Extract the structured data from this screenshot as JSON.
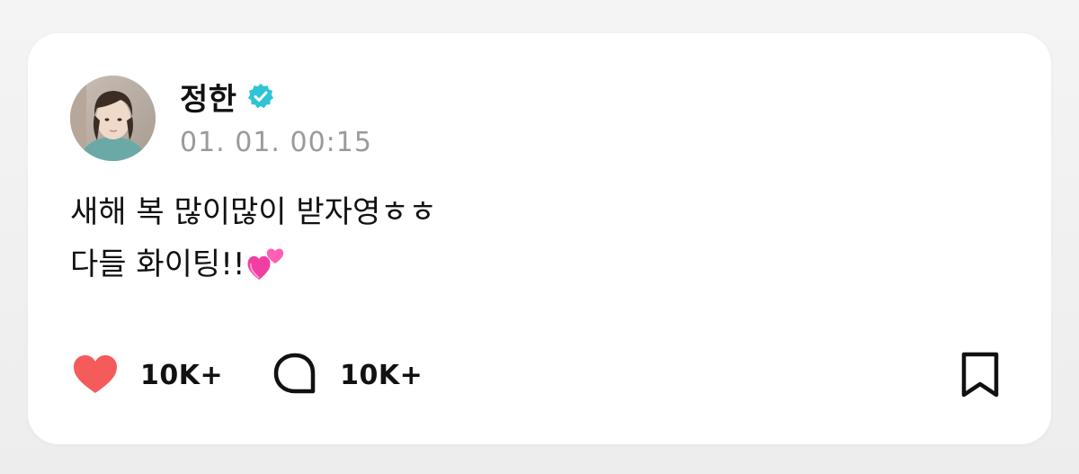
{
  "post": {
    "author_name": "정한",
    "verified_badge_color": "#2ec4d6",
    "timestamp": "01. 01. 00:15",
    "text_lines": [
      "새해 복 많이많이 받자영ㅎㅎ",
      "다들 화이팅!!"
    ],
    "emoji_icon": "two-hearts-emoji"
  },
  "actions": {
    "like_icon": "heart-icon",
    "like_color": "#f45b5b",
    "like_count": "10K+",
    "comment_icon": "comment-bubble-icon",
    "comment_count": "10K+",
    "bookmark_icon": "bookmark-icon"
  }
}
